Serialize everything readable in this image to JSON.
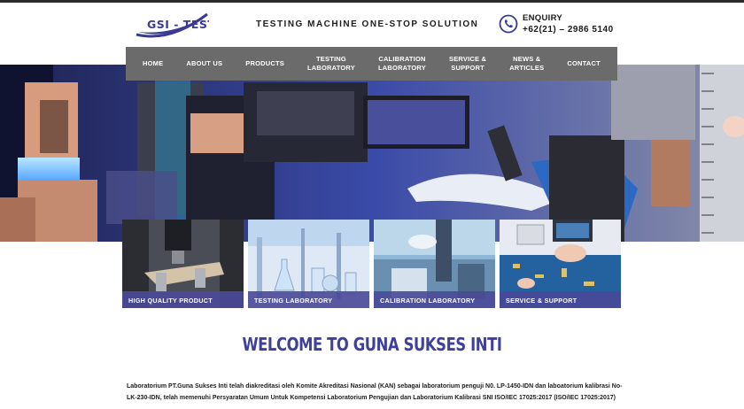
{
  "header": {
    "logo_text": "GSI - TEST",
    "tagline": "TESTING MACHINE ONE-STOP SOLUTION",
    "enquiry_label": "ENQUIRY",
    "enquiry_phone": "+62(21) – 2986 5140",
    "phone_icon": "phone-icon"
  },
  "nav": {
    "items": [
      {
        "line1": "HOME",
        "line2": ""
      },
      {
        "line1": "ABOUT US",
        "line2": ""
      },
      {
        "line1": "PRODUCTS",
        "line2": ""
      },
      {
        "line1": "TESTING",
        "line2": "LABORATORY"
      },
      {
        "line1": "CALIBRATION",
        "line2": "LABORATORY"
      },
      {
        "line1": "SERVICE &",
        "line2": "SUPPORT"
      },
      {
        "line1": "NEWS &",
        "line2": "ARTICLES"
      },
      {
        "line1": "CONTACT",
        "line2": ""
      }
    ]
  },
  "cards": [
    {
      "label": "HIGH QUALITY PRODUCT"
    },
    {
      "label": "TESTING LABORATORY"
    },
    {
      "label": "CALIBRATION LABORATORY"
    },
    {
      "label": "SERVICE & SUPPORT"
    }
  ],
  "welcome": {
    "title": "WELCOME TO GUNA SUKSES INTI",
    "text": "Laboratorium PT.Guna Sukses Inti telah diakreditasi oleh Komite Akreditasi Nasional (KAN) sebagai laboratorium penguji N0. LP-1450-IDN dan laboatorium kalibrasi No-LK-230-IDN, telah memenuhi Persyaratan Umum Untuk Kompetensi Laboratorium Pengujian dan Laboratorium Kalibrasi SNI ISO/IEC 17025:2017 (ISO/IEC 17025:2017)"
  },
  "colors": {
    "brand_blue": "#3f3f9c",
    "nav_gray": "#6b6b6b",
    "card_label_bg": "#4a4998"
  }
}
